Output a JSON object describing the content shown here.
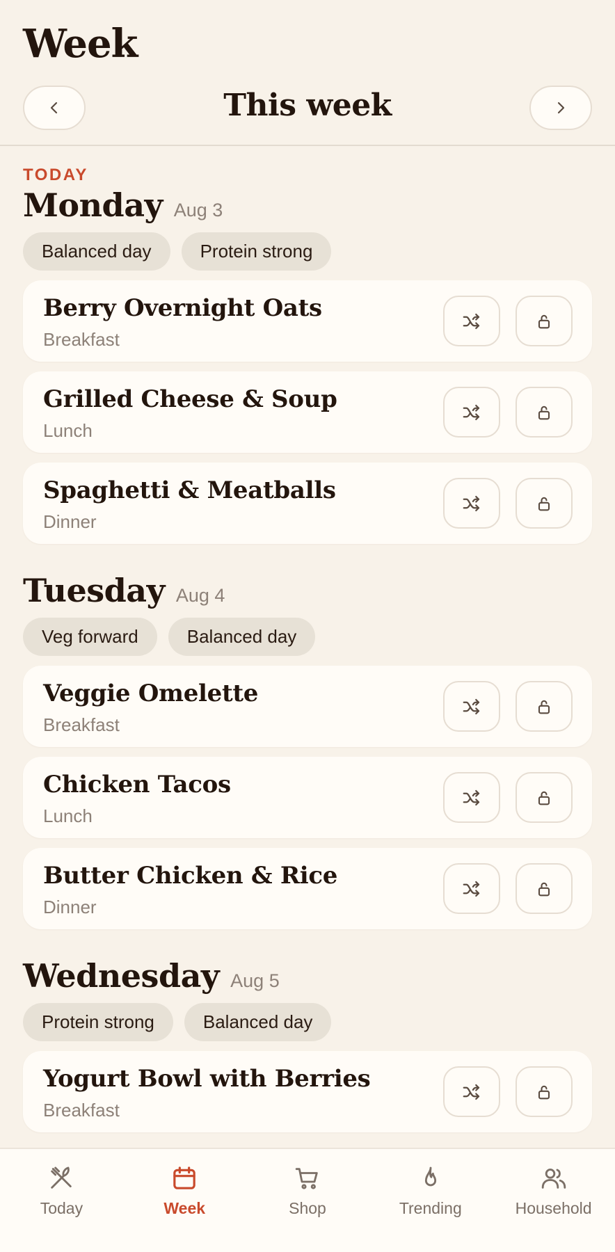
{
  "header": {
    "title": "Week",
    "week_label": "This week"
  },
  "days": [
    {
      "tag": "TODAY",
      "name": "Monday",
      "date": "Aug 3",
      "chips": [
        "Balanced day",
        "Protein strong"
      ],
      "meals": [
        {
          "name": "Berry Overnight Oats",
          "type": "Breakfast"
        },
        {
          "name": "Grilled Cheese & Soup",
          "type": "Lunch"
        },
        {
          "name": "Spaghetti & Meatballs",
          "type": "Dinner"
        }
      ]
    },
    {
      "name": "Tuesday",
      "date": "Aug 4",
      "chips": [
        "Veg forward",
        "Balanced day"
      ],
      "meals": [
        {
          "name": "Veggie Omelette",
          "type": "Breakfast"
        },
        {
          "name": "Chicken Tacos",
          "type": "Lunch"
        },
        {
          "name": "Butter Chicken & Rice",
          "type": "Dinner"
        }
      ]
    },
    {
      "name": "Wednesday",
      "date": "Aug 5",
      "chips": [
        "Protein strong",
        "Balanced day"
      ],
      "meals": [
        {
          "name": "Yogurt Bowl with Berries",
          "type": "Breakfast"
        }
      ]
    }
  ],
  "icons": {
    "prev": "chevron-left-icon",
    "next": "chevron-right-icon",
    "shuffle": "shuffle-icon",
    "lock": "unlock-icon"
  },
  "tabbar": {
    "active": "Week",
    "tabs": [
      {
        "label": "Today",
        "icon": "utensils-icon"
      },
      {
        "label": "Week",
        "icon": "calendar-icon"
      },
      {
        "label": "Shop",
        "icon": "cart-icon"
      },
      {
        "label": "Trending",
        "icon": "flame-icon"
      },
      {
        "label": "Household",
        "icon": "people-icon"
      }
    ]
  },
  "colors": {
    "background": "#f8f2e9",
    "card": "#fffcf7",
    "accent": "#c94a2c",
    "chip": "#e7e1d6",
    "muted_text": "#8d8178"
  }
}
